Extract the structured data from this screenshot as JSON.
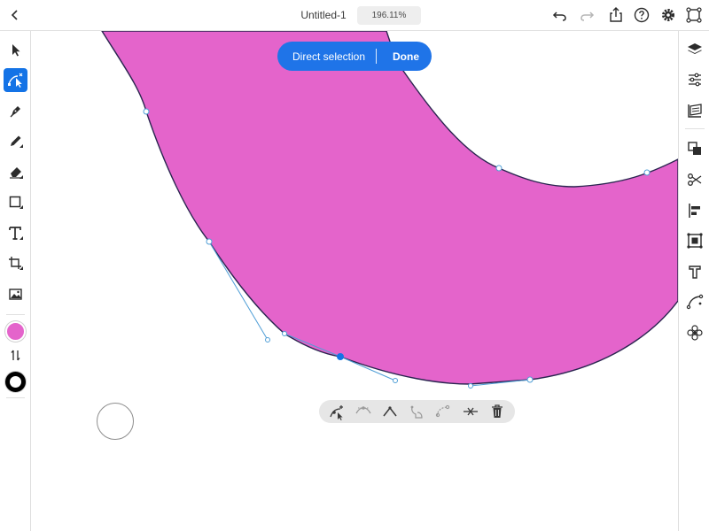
{
  "header": {
    "title": "Untitled-1",
    "zoom": "196.11%"
  },
  "mode_banner": {
    "label": "Direct selection",
    "done_label": "Done"
  },
  "colors": {
    "shape_fill": "#e464cb",
    "shape_stroke": "#2a2550",
    "accent": "#1473e6",
    "path_handles": "#4f9ed6"
  },
  "left_tools": [
    "selection-tool",
    "direct-selection-tool",
    "pen-tool",
    "pencil-tool",
    "eraser-tool",
    "shape-tool",
    "type-tool",
    "transform-tool",
    "image-tool"
  ],
  "right_tools": [
    "layers",
    "properties",
    "libraries",
    "arrange",
    "path-operations",
    "align",
    "repeat",
    "fonts",
    "curvature",
    "effects"
  ],
  "anchor_tools": [
    "add-anchor",
    "smooth-anchor",
    "corner-anchor",
    "join-anchors",
    "split-anchor",
    "remove-anchor",
    "delete"
  ]
}
